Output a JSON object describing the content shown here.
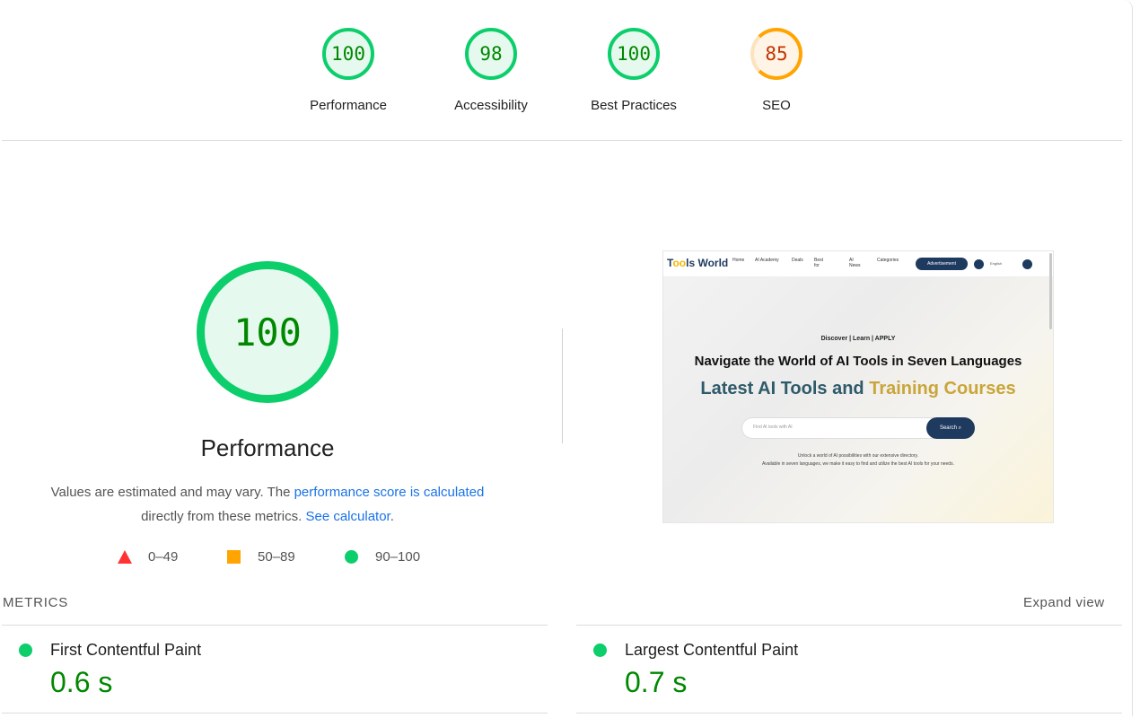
{
  "scores": [
    {
      "value": "100",
      "label": "Performance",
      "status": "pass"
    },
    {
      "value": "98",
      "label": "Accessibility",
      "status": "pass"
    },
    {
      "value": "100",
      "label": "Best Practices",
      "status": "pass"
    },
    {
      "value": "85",
      "label": "SEO",
      "status": "average"
    }
  ],
  "performance": {
    "score": "100",
    "title": "Performance",
    "desc_prefix": "Values are estimated and may vary. The ",
    "desc_link1": "performance score is calculated",
    "desc_middle": " directly from these metrics. ",
    "desc_link2": "See calculator",
    "desc_suffix": "."
  },
  "legend": [
    {
      "range": "0–49",
      "shape": "triangle",
      "color": "#ff3333"
    },
    {
      "range": "50–89",
      "shape": "square",
      "color": "#ffa400"
    },
    {
      "range": "90–100",
      "shape": "circle",
      "color": "#0cce6b"
    }
  ],
  "screenshot": {
    "logo_prefix": "T",
    "logo_oo": "oo",
    "logo_suffix": "ls World",
    "nav_home": "Home",
    "nav_ai_academy": "AI Academy",
    "nav_deals": "Deals",
    "nav_best_for": "Best for",
    "nav_ai_news": "AI News",
    "nav_categories": "Categories",
    "advertisement": "Advertisement",
    "language": "English",
    "tagline": "Discover | Learn | APPLY",
    "headline": "Navigate the World of AI Tools in Seven Languages",
    "subhead_part1": "Latest AI Tools and ",
    "subhead_part2": "Training Courses",
    "search_placeholder": "Find AI tools with AI",
    "search_button": "Search",
    "para1": "Unlock a world of AI possibilities with our extensive directory.",
    "para2": "Available in seven languages, we make it easy to find and utilize the best AI tools for your needs."
  },
  "metrics": {
    "header": "METRICS",
    "expand": "Expand view",
    "items": [
      {
        "name": "First Contentful Paint",
        "value": "0.6 s"
      },
      {
        "name": "Largest Contentful Paint",
        "value": "0.7 s"
      }
    ]
  },
  "colors": {
    "pass": "#0cce6b",
    "pass_text": "#008800",
    "average": "#ffa400",
    "average_text": "#c33300",
    "fail": "#ff3333",
    "link": "#1a73e8"
  }
}
